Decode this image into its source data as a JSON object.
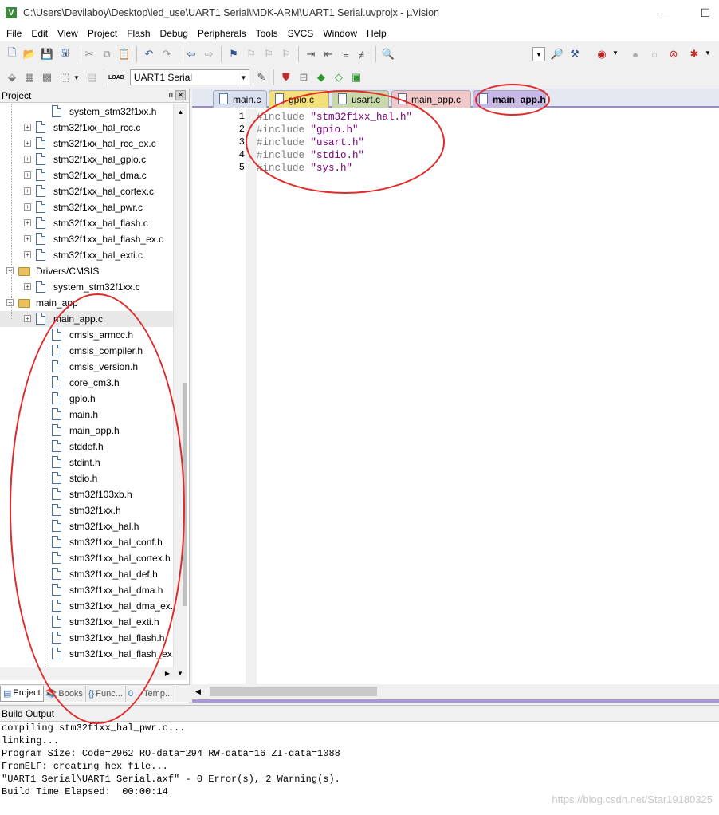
{
  "window": {
    "title": "C:\\Users\\Devilaboy\\Desktop\\led_use\\UART1 Serial\\MDK-ARM\\UART1 Serial.uvprojx - µVision",
    "icon_label": "V"
  },
  "menu": [
    "File",
    "Edit",
    "View",
    "Project",
    "Flash",
    "Debug",
    "Peripherals",
    "Tools",
    "SVCS",
    "Window",
    "Help"
  ],
  "toolbar": {
    "target": "UART1 Serial",
    "load_label": "LOAD"
  },
  "project_panel": {
    "title": "Project",
    "tree": [
      {
        "label": "system_stm32f1xx.h",
        "kind": "file",
        "depth": 3
      },
      {
        "label": "stm32f1xx_hal_rcc.c",
        "kind": "file",
        "depth": 2,
        "expander": true
      },
      {
        "label": "stm32f1xx_hal_rcc_ex.c",
        "kind": "file",
        "depth": 2,
        "expander": true
      },
      {
        "label": "stm32f1xx_hal_gpio.c",
        "kind": "file",
        "depth": 2,
        "expander": true
      },
      {
        "label": "stm32f1xx_hal_dma.c",
        "kind": "file",
        "depth": 2,
        "expander": true
      },
      {
        "label": "stm32f1xx_hal_cortex.c",
        "kind": "file",
        "depth": 2,
        "expander": true
      },
      {
        "label": "stm32f1xx_hal_pwr.c",
        "kind": "file",
        "depth": 2,
        "expander": true
      },
      {
        "label": "stm32f1xx_hal_flash.c",
        "kind": "file",
        "depth": 2,
        "expander": true
      },
      {
        "label": "stm32f1xx_hal_flash_ex.c",
        "kind": "file",
        "depth": 2,
        "expander": true
      },
      {
        "label": "stm32f1xx_hal_exti.c",
        "kind": "file",
        "depth": 2,
        "expander": true
      },
      {
        "label": "Drivers/CMSIS",
        "kind": "folder",
        "depth": 1,
        "expander": true
      },
      {
        "label": "system_stm32f1xx.c",
        "kind": "file",
        "depth": 2,
        "expander": true
      },
      {
        "label": "main_app",
        "kind": "folder",
        "depth": 1,
        "expander": true
      },
      {
        "label": "main_app.c",
        "kind": "file",
        "depth": 2,
        "expander": true,
        "selected": true
      },
      {
        "label": "cmsis_armcc.h",
        "kind": "file",
        "depth": 3
      },
      {
        "label": "cmsis_compiler.h",
        "kind": "file",
        "depth": 3
      },
      {
        "label": "cmsis_version.h",
        "kind": "file",
        "depth": 3
      },
      {
        "label": "core_cm3.h",
        "kind": "file",
        "depth": 3
      },
      {
        "label": "gpio.h",
        "kind": "file",
        "depth": 3
      },
      {
        "label": "main.h",
        "kind": "file",
        "depth": 3
      },
      {
        "label": "main_app.h",
        "kind": "file",
        "depth": 3
      },
      {
        "label": "stddef.h",
        "kind": "file",
        "depth": 3
      },
      {
        "label": "stdint.h",
        "kind": "file",
        "depth": 3
      },
      {
        "label": "stdio.h",
        "kind": "file",
        "depth": 3
      },
      {
        "label": "stm32f103xb.h",
        "kind": "file",
        "depth": 3
      },
      {
        "label": "stm32f1xx.h",
        "kind": "file",
        "depth": 3
      },
      {
        "label": "stm32f1xx_hal.h",
        "kind": "file",
        "depth": 3
      },
      {
        "label": "stm32f1xx_hal_conf.h",
        "kind": "file",
        "depth": 3
      },
      {
        "label": "stm32f1xx_hal_cortex.h",
        "kind": "file",
        "depth": 3
      },
      {
        "label": "stm32f1xx_hal_def.h",
        "kind": "file",
        "depth": 3
      },
      {
        "label": "stm32f1xx_hal_dma.h",
        "kind": "file",
        "depth": 3
      },
      {
        "label": "stm32f1xx_hal_dma_ex.h",
        "kind": "file",
        "depth": 3
      },
      {
        "label": "stm32f1xx_hal_exti.h",
        "kind": "file",
        "depth": 3
      },
      {
        "label": "stm32f1xx_hal_flash.h",
        "kind": "file",
        "depth": 3
      },
      {
        "label": "stm32f1xx_hal_flash_ex.h",
        "kind": "file",
        "depth": 3
      }
    ],
    "bottom_tabs": [
      {
        "label": "Project",
        "icon": "project-icon",
        "active": true
      },
      {
        "label": "Books",
        "icon": "books-icon",
        "active": false
      },
      {
        "label": "Func...",
        "icon": "functions-icon",
        "active": false
      },
      {
        "label": "Temp...",
        "icon": "templates-icon",
        "active": false
      }
    ]
  },
  "editor": {
    "tabs": [
      {
        "label": "main.c",
        "color": "#d8e0f0"
      },
      {
        "label": "gpio.c",
        "color": "#f4e07a"
      },
      {
        "label": "usart.c",
        "color": "#c8d8a8"
      },
      {
        "label": "main_app.c",
        "color": "#f0c8c8"
      },
      {
        "label": "main_app.h",
        "color": "#c8b8e8",
        "active": true
      }
    ],
    "lines": [
      {
        "num": "1",
        "kw": "#include",
        "str": "\"stm32f1xx_hal.h\""
      },
      {
        "num": "2",
        "kw": "#include",
        "str": "\"gpio.h\""
      },
      {
        "num": "3",
        "kw": "#include",
        "str": "\"usart.h\""
      },
      {
        "num": "4",
        "kw": "#include",
        "str": "\"stdio.h\""
      },
      {
        "num": "5",
        "kw": "#include",
        "str": "\"sys.h\""
      }
    ]
  },
  "build_output": {
    "title": "Build Output",
    "lines": [
      "compiling stm32f1xx_hal_pwr.c...",
      "linking...",
      "Program Size: Code=2962 RO-data=294 RW-data=16 ZI-data=1088",
      "FromELF: creating hex file...",
      "\"UART1 Serial\\UART1 Serial.axf\" - 0 Error(s), 2 Warning(s).",
      "Build Time Elapsed:  00:00:14"
    ],
    "watermark": "https://blog.csdn.net/Star19180325"
  },
  "colors": {
    "annotation": "#e02a2a",
    "keyword": "#7a7a7a",
    "string": "#800080"
  }
}
